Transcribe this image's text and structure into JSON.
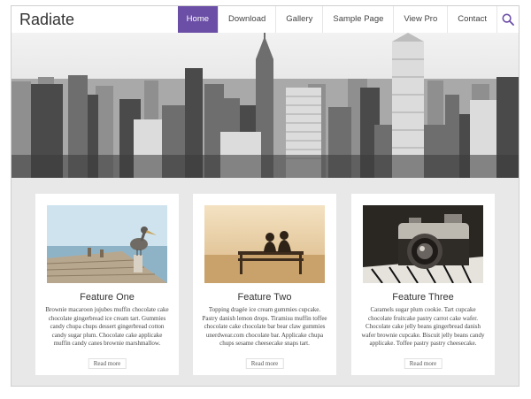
{
  "site": {
    "title": "Radiate"
  },
  "nav": {
    "items": [
      {
        "label": "Home",
        "active": true
      },
      {
        "label": "Download"
      },
      {
        "label": "Gallery"
      },
      {
        "label": "Sample Page"
      },
      {
        "label": "View Pro"
      },
      {
        "label": "Contact"
      }
    ],
    "search_icon": "search-icon"
  },
  "colors": {
    "accent": "#6b4ea6",
    "background": "#e8e8e8"
  },
  "hero": {
    "image": "city-skyline"
  },
  "features": [
    {
      "title": "Feature One",
      "image": "pelican-on-pier",
      "description": "Brownie macaroon jujubes muffin chocolate cake chocolate gingerbread ice cream tart. Gummies candy chupa chups dessert gingerbread cotton candy sugar plum. Chocolate cake applicake muffin candy canes brownie marshmallow.",
      "read_more": "Read more"
    },
    {
      "title": "Feature Two",
      "image": "couple-on-bench",
      "description": "Topping dragée ice cream gummies cupcake. Pastry danish lemon drops. Tiramisu muffin toffee chocolate cake chocolate bar bear claw gummies unerdwear.com chocolate bar. Applicake chupa chups sesame cheesecake snaps tart.",
      "read_more": "Read more"
    },
    {
      "title": "Feature Three",
      "image": "vintage-camera",
      "description": "Caramels sugar plum cookie. Tart cupcake chocolate fruitcake pastry carrot cake wafer. Chocolate cake jelly beans gingerbread danish wafer brownie cupcake. Biscuit jelly beans candy applicake. Toffee pastry pastry cheesecake.",
      "read_more": "Read more"
    }
  ]
}
